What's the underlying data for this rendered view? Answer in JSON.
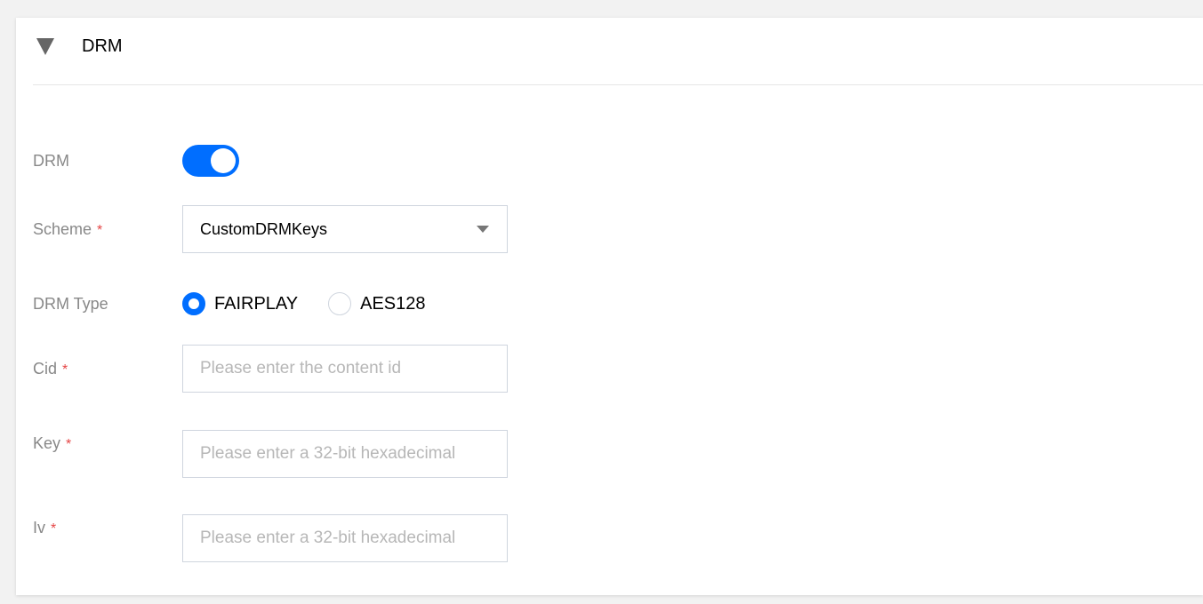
{
  "section": {
    "title": "DRM",
    "expanded": true
  },
  "form": {
    "drm": {
      "label": "DRM",
      "enabled": true
    },
    "scheme": {
      "label": "Scheme",
      "required_mark": "*",
      "value": "CustomDRMKeys"
    },
    "drm_type": {
      "label": "DRM Type",
      "options": [
        {
          "label": "FAIRPLAY",
          "selected": true
        },
        {
          "label": "AES128",
          "selected": false
        }
      ]
    },
    "cid": {
      "label": "Cid",
      "required_mark": "*",
      "value": "",
      "placeholder": "Please enter the content id"
    },
    "key": {
      "label": "Key",
      "required_mark": "*",
      "value": "",
      "placeholder": "Please enter a 32-bit hexadecimal"
    },
    "iv": {
      "label": "Iv",
      "required_mark": "*",
      "value": "",
      "placeholder": "Please enter a 32-bit hexadecimal"
    }
  },
  "colors": {
    "accent": "#006eff",
    "required": "#e54545",
    "label": "#888888",
    "border": "#cfd5de"
  },
  "icons": {
    "collapse": "triangle-down-icon",
    "select_caret": "chevron-down-icon"
  }
}
